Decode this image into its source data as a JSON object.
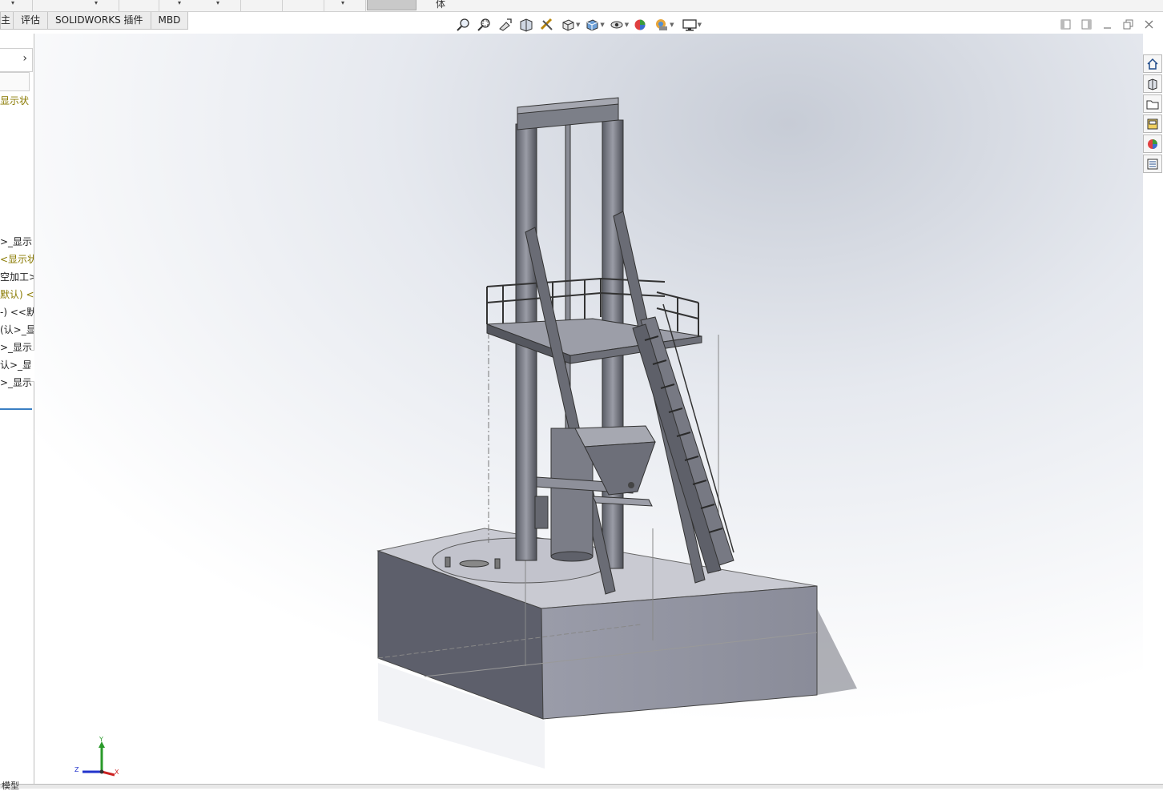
{
  "toprow": {
    "active_label": "体"
  },
  "tabs": [
    {
      "label": "主"
    },
    {
      "label": "评估"
    },
    {
      "label": "SOLIDWORKS 插件"
    },
    {
      "label": "MBD"
    }
  ],
  "hud_icons": [
    "zoom-to-fit-icon",
    "zoom-to-area-icon",
    "previous-view-icon",
    "section-view-icon",
    "dynamic-annotation-icon",
    "view-orientation-icon",
    "display-style-icon",
    "hide-show-items-icon",
    "edit-appearance-icon",
    "apply-scene-icon",
    "view-settings-icon"
  ],
  "window_controls": [
    "tile-left-icon",
    "tile-right-icon",
    "minimize-icon",
    "restore-icon",
    "close-icon"
  ],
  "feature_tree": {
    "top_item": "显示状",
    "items": [
      ">_显示",
      "<显示状",
      "空加工>",
      "默认) <",
      "-) <<默",
      "(认>_显",
      ">_显示",
      "认>_显",
      ">_显示"
    ]
  },
  "task_pane": [
    "solidworks-resources-icon",
    "design-library-icon",
    "file-explorer-icon",
    "view-palette-icon",
    "appearances-scenes-icon",
    "custom-properties-icon"
  ],
  "triad": {
    "y": "Y",
    "x": "X",
    "z": "Z"
  },
  "status": {
    "tab_label": "模型"
  }
}
